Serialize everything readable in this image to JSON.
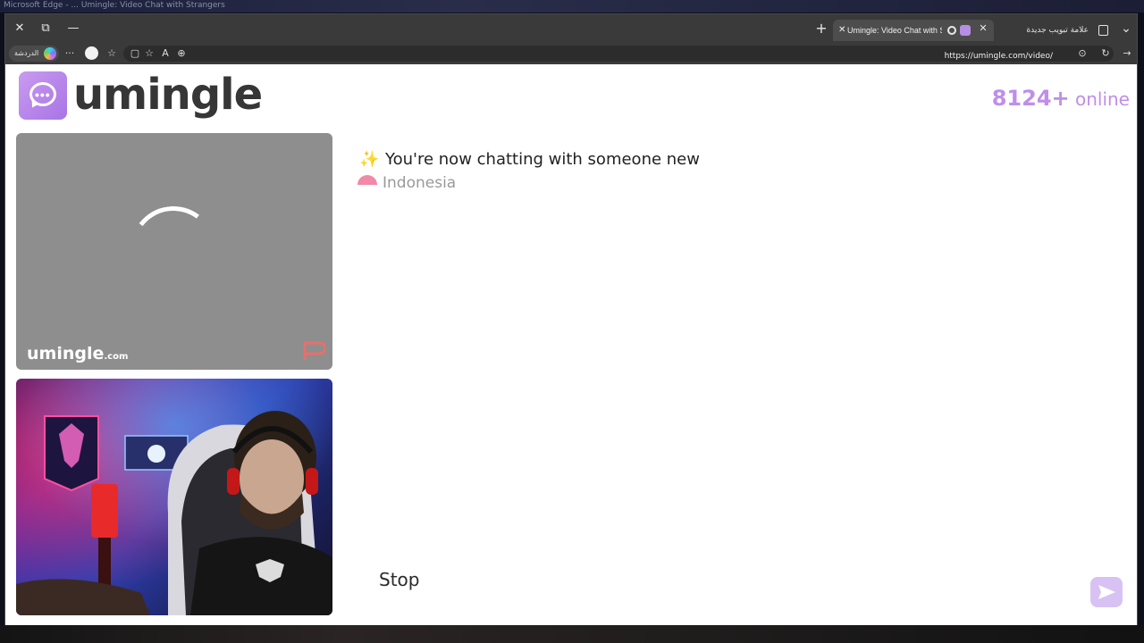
{
  "desktop": {
    "window_caption": "Microsoft Edge - ... Umingle: Video Chat with Strangers"
  },
  "browser": {
    "window_controls": {
      "close": "✕",
      "restore": "⧉",
      "minimize": "—"
    },
    "new_tab": "+",
    "tabs": [
      {
        "title": "Umingle: Video Chat with Strangers",
        "active": true,
        "close": "✕"
      },
      {
        "title": "علامة تبويب جديدة",
        "active": false,
        "close": "✕"
      }
    ],
    "tab_list_toggle": "⌄",
    "profile_label": "الدردشة",
    "address": {
      "url": "https://umingle.com/video/"
    },
    "toolbar_icons": [
      "more-icon",
      "avatar-icon",
      "favorites-icon",
      "split-screen-icon",
      "star-icon",
      "read-aloud-icon",
      "zoom-icon",
      "lock-icon",
      "refresh-icon",
      "forward-icon"
    ],
    "glyphs": {
      "more": "···",
      "favorites": "☆",
      "star": "☆",
      "read_aloud": "A",
      "zoom": "⊕",
      "lock": "⊙",
      "refresh": "↻",
      "forward": "→",
      "split": "▢"
    }
  },
  "site": {
    "brand": "umingle",
    "online_count": "8124+",
    "online_label": "online",
    "remote_video": {
      "watermark": "umingle",
      "watermark_domain": ".com"
    },
    "chat": {
      "sparkle": "✨",
      "status_message": "You're now chatting with someone new",
      "country": "Indonesia"
    },
    "stop_label": "Stop"
  },
  "colors": {
    "brand_purple": "#c08ee8",
    "send_button": "#d8c2f3",
    "video_placeholder": "#8e8e8e"
  }
}
